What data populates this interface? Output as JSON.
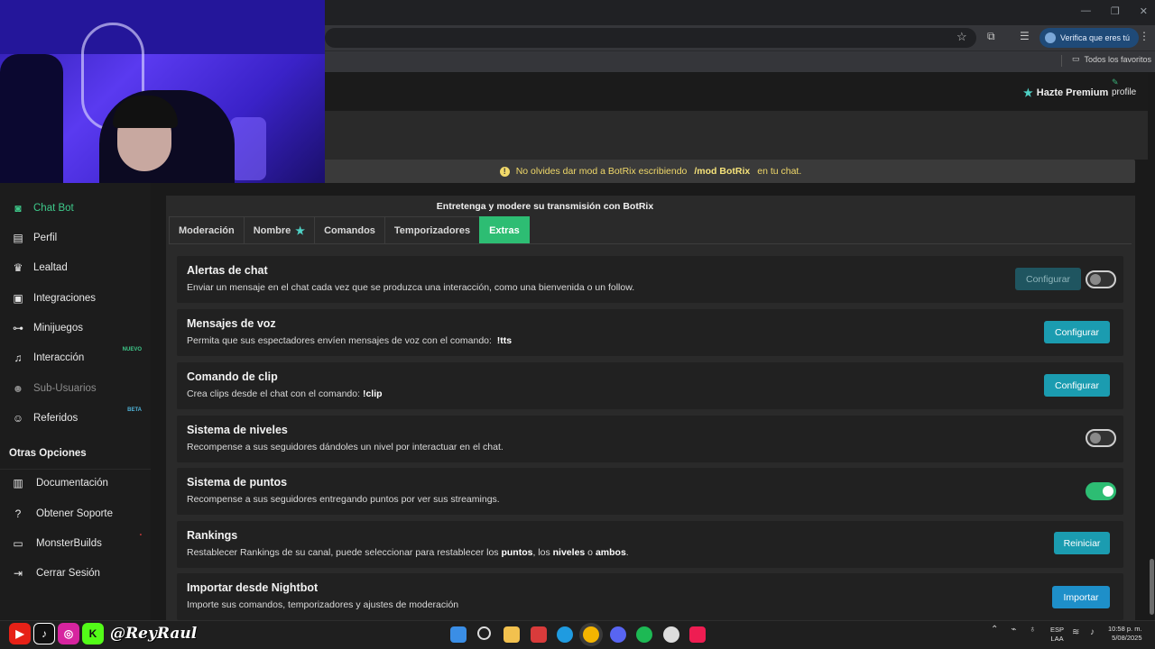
{
  "browser": {
    "verify_label": "Verifica que eres tú",
    "bookmarks_all": "Todos los favoritos"
  },
  "header": {
    "premium": "Hazte Premium",
    "profile": "profile"
  },
  "notice": {
    "before": "No olvides dar mod a BotRix escribiendo",
    "command": "/mod BotRix",
    "after": "en tu chat."
  },
  "sidebar": {
    "items": [
      {
        "label": "Chat Bot",
        "icon": "robot-icon"
      },
      {
        "label": "Perfil",
        "icon": "id-card-icon"
      },
      {
        "label": "Lealtad",
        "icon": "trophy-icon"
      },
      {
        "label": "Integraciones",
        "icon": "integrations-icon"
      },
      {
        "label": "Minijuegos",
        "icon": "gamepad-icon"
      },
      {
        "label": "Interacción",
        "icon": "music-icon",
        "badge": "NUEVO"
      },
      {
        "label": "Sub-Usuarios",
        "icon": "users-icon"
      },
      {
        "label": "Referidos",
        "icon": "referrals-icon",
        "badge": "BETA"
      }
    ],
    "other_title": "Otras Opciones",
    "other": [
      {
        "label": "Documentación",
        "icon": "book-icon"
      },
      {
        "label": "Obtener Soporte",
        "icon": "help-icon"
      },
      {
        "label": "MonsterBuilds",
        "icon": "laptop-icon"
      },
      {
        "label": "Cerrar Sesión",
        "icon": "logout-icon"
      }
    ]
  },
  "panel": {
    "title": "Entretenga y modere su transmisión con BotRix",
    "tabs": [
      "Moderación",
      "Nombre",
      "Comandos",
      "Temporizadores",
      "Extras"
    ],
    "active_tab": "Extras"
  },
  "cards": [
    {
      "title": "Alertas de chat",
      "desc": "Enviar un mensaje en el chat cada vez que se produzca una interacción, como una bienvenida o un follow.",
      "button": "Configurar",
      "toggle": "off"
    },
    {
      "title": "Mensajes de voz",
      "desc": "Permita que sus espectadores envíen mensajes de voz con el comando:",
      "command": "!tts",
      "button": "Configurar"
    },
    {
      "title": "Comando de clip",
      "desc": "Crea clips desde el chat con el comando:",
      "command": "!clip",
      "button": "Configurar"
    },
    {
      "title": "Sistema de niveles",
      "desc": "Recompense a sus seguidores dándoles un nivel por interactuar en el chat.",
      "toggle": "off"
    },
    {
      "title": "Sistema de puntos",
      "desc": "Recompense a sus seguidores entregando puntos por ver sus streamings.",
      "toggle": "on"
    },
    {
      "title": "Rankings",
      "desc_parts": [
        "Restablecer Rankings de su canal, puede seleccionar para restablecer los ",
        "puntos",
        ", los ",
        "niveles",
        " o ",
        "ambos",
        "."
      ],
      "button": "Reiniciar"
    },
    {
      "title": "Importar desde Nightbot",
      "desc": "Importe sus comandos, temporizadores y ajustes de moderación",
      "button": "Importar"
    }
  ],
  "overlay": {
    "handle": "@ReyRaul"
  },
  "taskbar": {
    "lang_1": "ESP",
    "lang_2": "LAA",
    "time": "10:58 p. m.",
    "date": "5/08/2025"
  },
  "colors": {
    "accent_green": "#2dbd73",
    "button_teal": "#1b9cb0",
    "notice_yellow": "#f1d96a"
  }
}
